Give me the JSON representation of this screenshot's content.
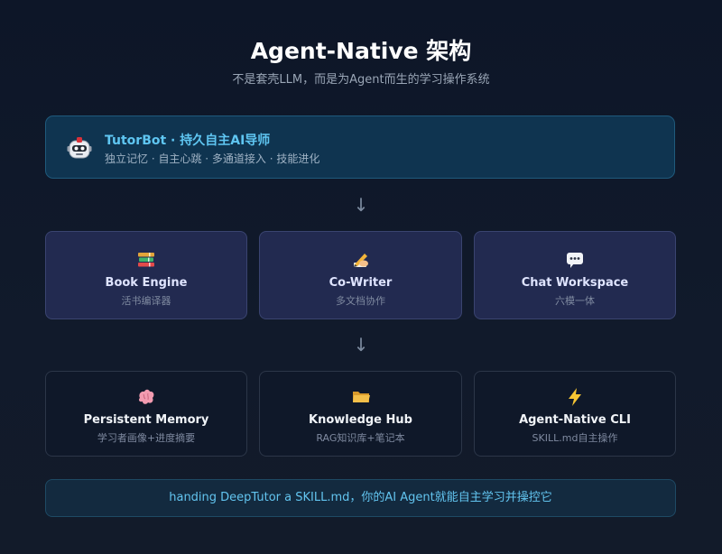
{
  "header": {
    "title": "Agent-Native 架构",
    "subtitle": "不是套壳LLM，而是为Agent而生的学习操作系统"
  },
  "tutorbot": {
    "icon": "robot-icon",
    "title": "TutorBot · 持久自主AI导师",
    "subtitle": "独立记忆 · 自主心跳 · 多通道接入 · 技能进化"
  },
  "arrows": {
    "glyph": "↓"
  },
  "modules": [
    {
      "icon": "books-icon",
      "name": "Book Engine",
      "desc": "活书编译器"
    },
    {
      "icon": "writing-hand-icon",
      "name": "Co-Writer",
      "desc": "多文档协作"
    },
    {
      "icon": "speech-bubble-icon",
      "name": "Chat Workspace",
      "desc": "六模一体"
    }
  ],
  "foundation": [
    {
      "icon": "brain-icon",
      "name": "Persistent Memory",
      "desc": "学习者画像+进度摘要"
    },
    {
      "icon": "folder-icon",
      "name": "Knowledge Hub",
      "desc": "RAG知识库+笔记本"
    },
    {
      "icon": "lightning-icon",
      "name": "Agent-Native CLI",
      "desc": "SKILL.md自主操作"
    }
  ],
  "footer": {
    "text": "handing DeepTutor a SKILL.md，你的AI Agent就能自主学习并操控它"
  },
  "colors": {
    "accent": "#5fc6f2",
    "module_bg": "#222a50",
    "foundation_bg": "#0f1829",
    "tutor_bg": "#0f3450"
  }
}
